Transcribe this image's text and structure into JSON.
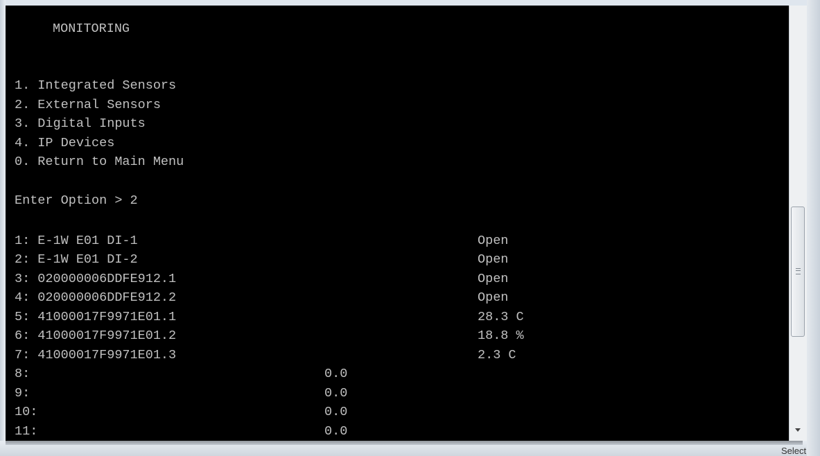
{
  "terminal": {
    "title": "MONITORING",
    "menu": [
      "1. Integrated Sensors",
      "2. External Sensors",
      "3. Digital Inputs",
      "4. IP Devices",
      "0. Return to Main Menu"
    ],
    "prompt": "Enter Option > 2",
    "sensors": [
      {
        "label": "1: E-1W E01 DI-1",
        "mid": "",
        "value": "Open"
      },
      {
        "label": "2: E-1W E01 DI-2",
        "mid": "",
        "value": "Open"
      },
      {
        "label": "3: 020000006DDFE912.1",
        "mid": "",
        "value": "Open"
      },
      {
        "label": "4: 020000006DDFE912.2",
        "mid": "",
        "value": "Open"
      },
      {
        "label": "5: 41000017F9971E01.1",
        "mid": "",
        "value": "28.3 C"
      },
      {
        "label": "6: 41000017F9971E01.2",
        "mid": "",
        "value": "18.8 %"
      },
      {
        "label": "7: 41000017F9971E01.3",
        "mid": "",
        "value": "2.3 C"
      },
      {
        "label": "8:",
        "mid": "0.0",
        "value": ""
      },
      {
        "label": "9:",
        "mid": "0.0",
        "value": ""
      },
      {
        "label": "10:",
        "mid": "0.0",
        "value": ""
      },
      {
        "label": "11:",
        "mid": "0.0",
        "value": ""
      }
    ]
  },
  "taskbar": {
    "text": "Select"
  }
}
